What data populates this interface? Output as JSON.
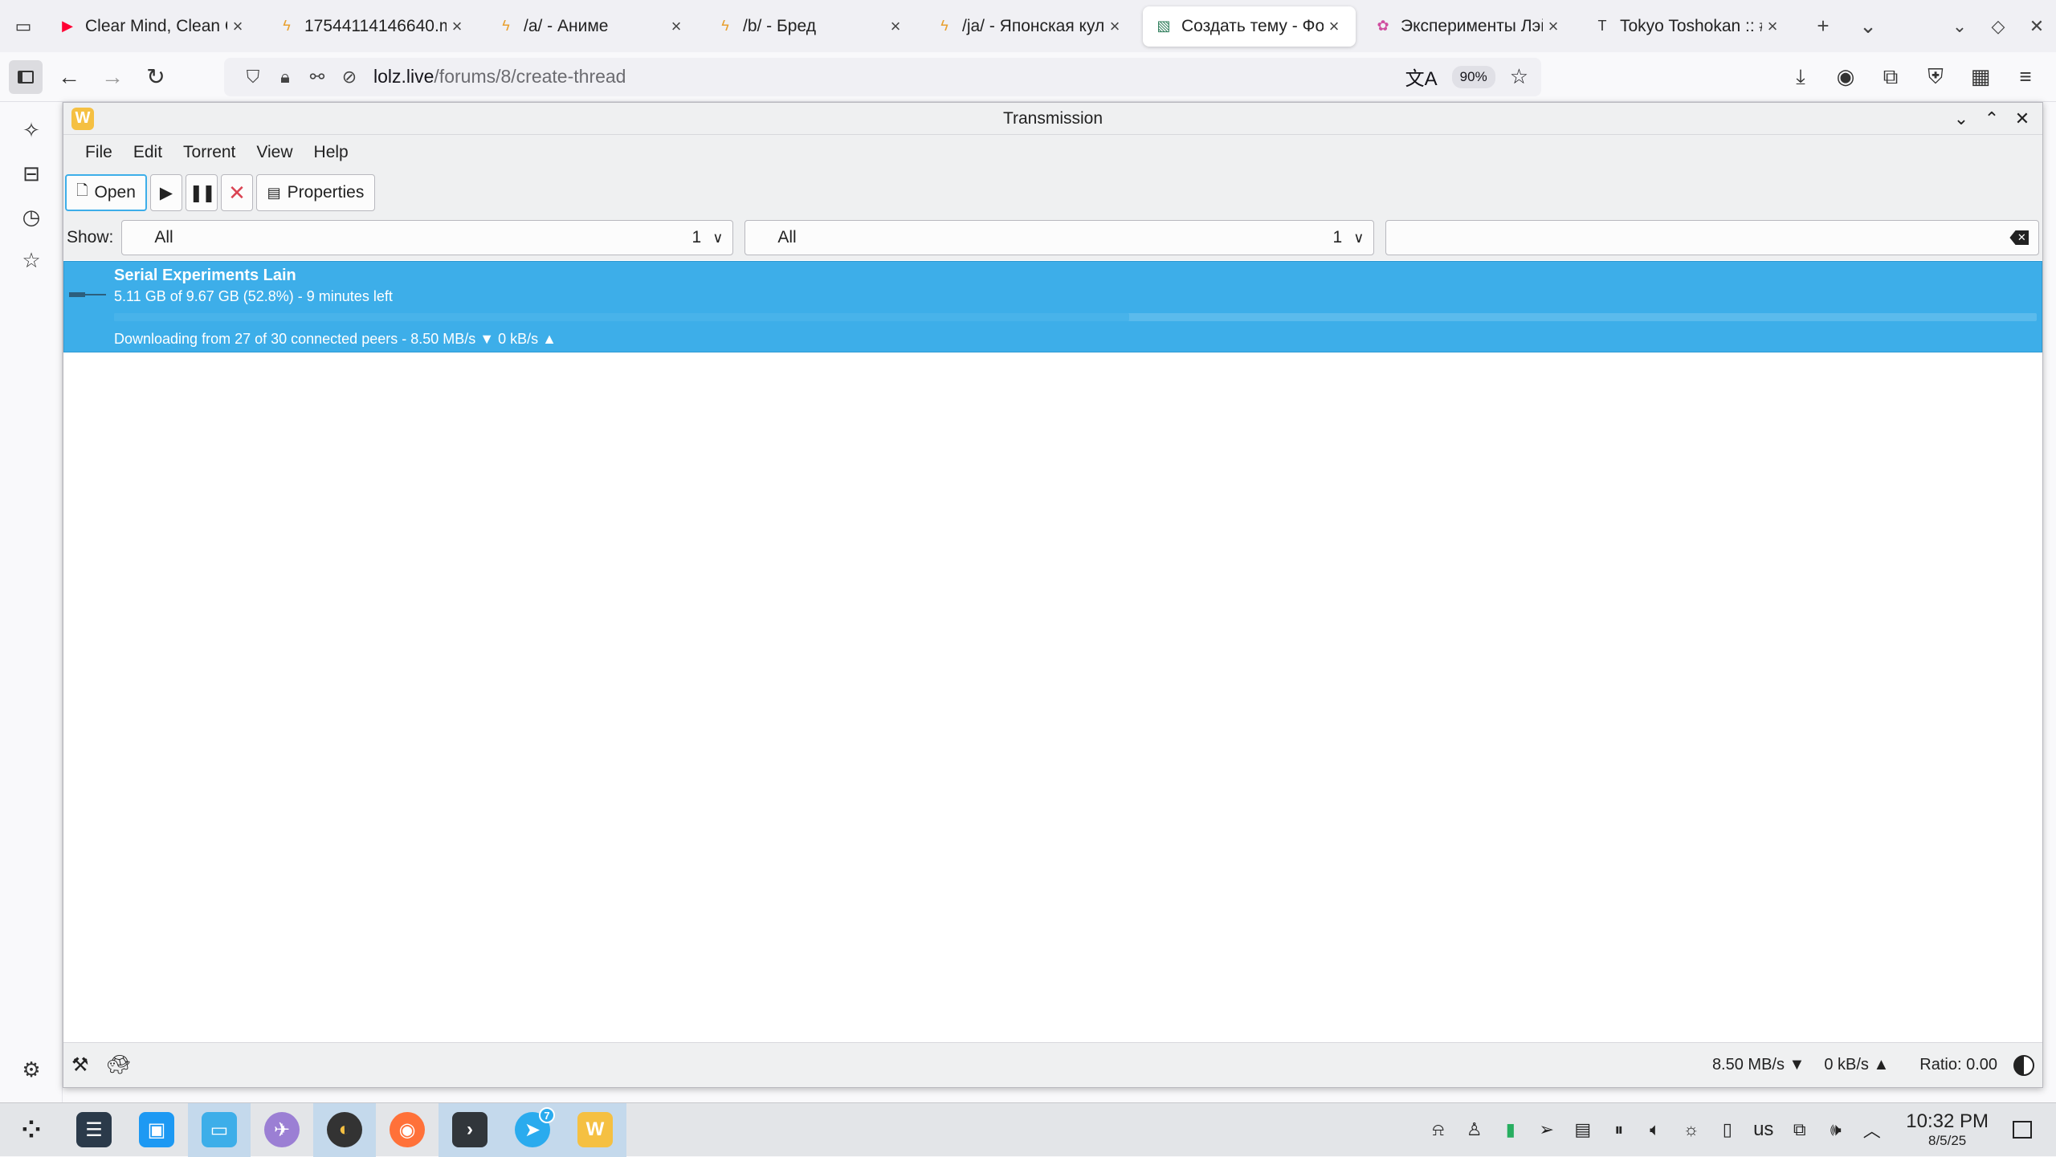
{
  "browser": {
    "tabs": [
      {
        "title": "Clear Mind, Clean C",
        "icon": "youtube-icon",
        "active": false
      },
      {
        "title": "17544114146640.m",
        "icon": "lightning-icon",
        "active": false
      },
      {
        "title": "/a/ - Аниме",
        "icon": "lightning-icon",
        "active": false
      },
      {
        "title": "/b/ - Бред",
        "icon": "lightning-icon",
        "active": false
      },
      {
        "title": "/ja/ - Японская кульу",
        "icon": "lightning-icon",
        "active": false
      },
      {
        "title": "Создать тему - Фор",
        "icon": "forum-icon",
        "active": true
      },
      {
        "title": "Эксперименты Лэй",
        "icon": "flower-icon",
        "active": false
      },
      {
        "title": "Tokyo Toshokan :: #",
        "icon": "t-icon",
        "active": false
      }
    ],
    "url_domain": "lolz.live",
    "url_path": "/forums/8/create-thread",
    "zoom": "90%"
  },
  "transmission": {
    "title": "Transmission",
    "menu": [
      "File",
      "Edit",
      "Torrent",
      "View",
      "Help"
    ],
    "toolbar": {
      "open_label": "Open",
      "properties_label": "Properties"
    },
    "filter": {
      "show_label": "Show:",
      "combo1_value": "All",
      "combo1_count": "1",
      "combo2_value": "All",
      "combo2_count": "1"
    },
    "torrents": [
      {
        "name": "Serial Experiments Lain",
        "progress_text": "5.11 GB of 9.67 GB (52.8%) - 9 minutes left",
        "progress_fraction": 0.528,
        "status_text": "Downloading from 27 of 30 connected peers - 8.50 MB/s ▼  0 kB/s ▲"
      }
    ],
    "statusbar": {
      "down_speed": "8.50 MB/s ▼",
      "up_speed": "0 kB/s ▲",
      "ratio": "Ratio: 0.00"
    }
  },
  "taskbar": {
    "keyboard_layout": "us",
    "time": "10:32 PM",
    "date": "8/5/25",
    "telegram_badge": "7"
  },
  "colors": {
    "selection": "#3daee9",
    "accent": "#3daee9",
    "stop_red": "#da4453"
  }
}
